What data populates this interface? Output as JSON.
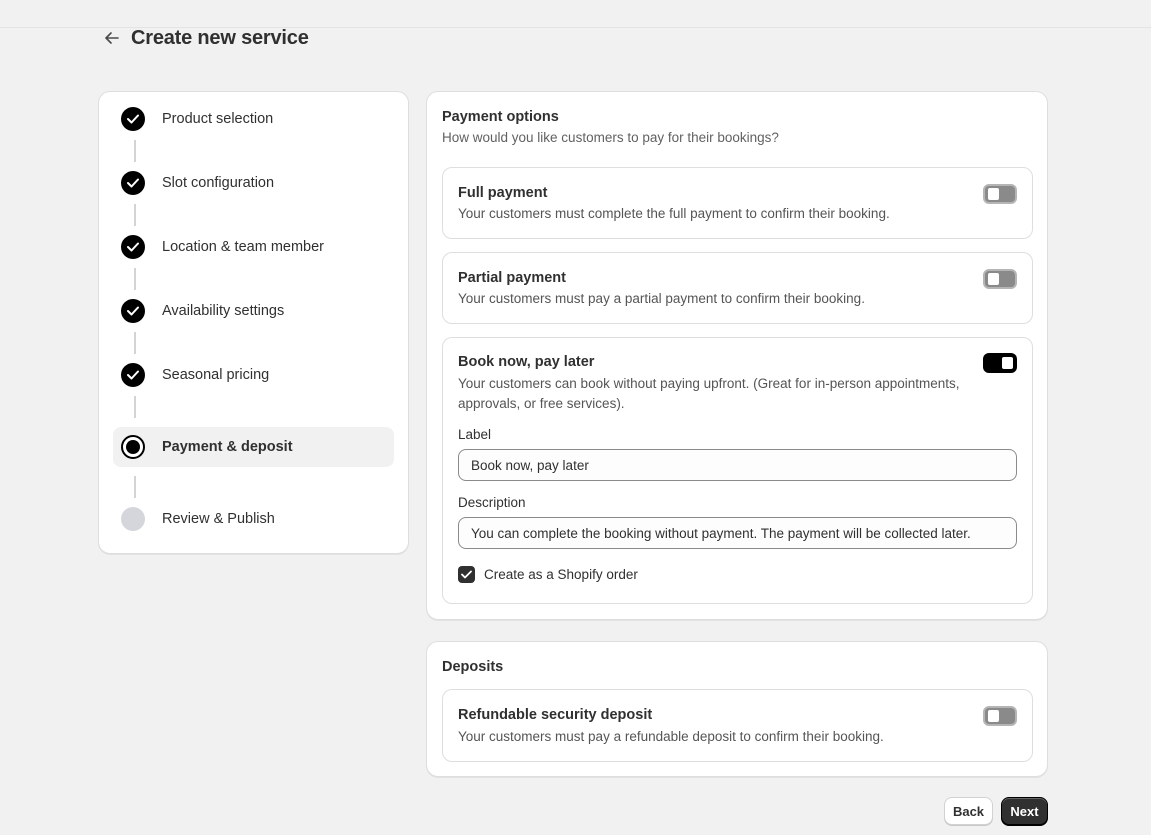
{
  "header": {
    "title": "Create new service",
    "back_icon": "arrow-left-icon"
  },
  "steps": [
    {
      "label": "Product selection",
      "status": "done"
    },
    {
      "label": "Slot configuration",
      "status": "done"
    },
    {
      "label": "Location & team member",
      "status": "done"
    },
    {
      "label": "Availability settings",
      "status": "done"
    },
    {
      "label": "Seasonal pricing",
      "status": "done"
    },
    {
      "label": "Payment & deposit",
      "status": "current"
    },
    {
      "label": "Review & Publish",
      "status": "pending"
    }
  ],
  "payment": {
    "title": "Payment options",
    "subtitle": "How would you like customers to pay for their bookings?",
    "options": [
      {
        "title": "Full payment",
        "description": "Your customers must complete the full payment to confirm their booking.",
        "enabled": false
      },
      {
        "title": "Partial payment",
        "description": "Your customers must pay a partial payment to confirm their booking.",
        "enabled": false
      },
      {
        "title": "Book now, pay later",
        "description": "Your customers can book without paying upfront. (Great for in-person appointments, approvals, or free services).",
        "enabled": true
      }
    ],
    "pay_later": {
      "label_field_label": "Label",
      "label_value": "Book now, pay later",
      "description_field_label": "Description",
      "description_value": "You can complete the booking without payment. The payment will be collected later.",
      "checkbox_label": "Create as a Shopify order",
      "checkbox_checked": true
    }
  },
  "deposits": {
    "title": "Deposits",
    "option": {
      "title": "Refundable security deposit",
      "description": "Your customers must pay a refundable deposit to confirm their booking.",
      "enabled": false
    }
  },
  "footer": {
    "back_label": "Back",
    "next_label": "Next"
  },
  "colors": {
    "background": "#f1f1f1",
    "primary": "#303030",
    "toggle_on": "#000000",
    "toggle_off": "#8a8a8a"
  }
}
